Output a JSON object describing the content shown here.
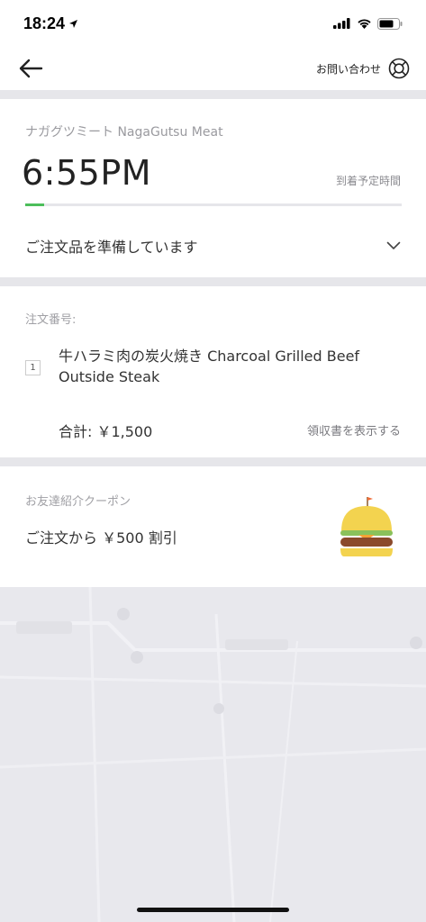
{
  "status_bar": {
    "time": "18:24"
  },
  "nav": {
    "help_label": "お問い合わせ"
  },
  "delivery": {
    "restaurant": "ナガグツミート NagaGutsu Meat",
    "eta": "6:55PM",
    "eta_label": "到着予定時間",
    "progress": 0.05,
    "progress_color": "#4cbe5b",
    "status": "ご注文品を準備しています"
  },
  "order": {
    "number_label": "注文番号:",
    "items": [
      {
        "qty": "1",
        "name": "牛ハラミ肉の炭火焼き Charcoal Grilled Beef Outside Steak"
      }
    ],
    "total": "合計: ￥1,500",
    "receipt_link": "領収書を表示する"
  },
  "coupon": {
    "label": "お友達紹介クーポン",
    "text": "ご注文から ￥500 割引",
    "icon": "burger-icon"
  }
}
